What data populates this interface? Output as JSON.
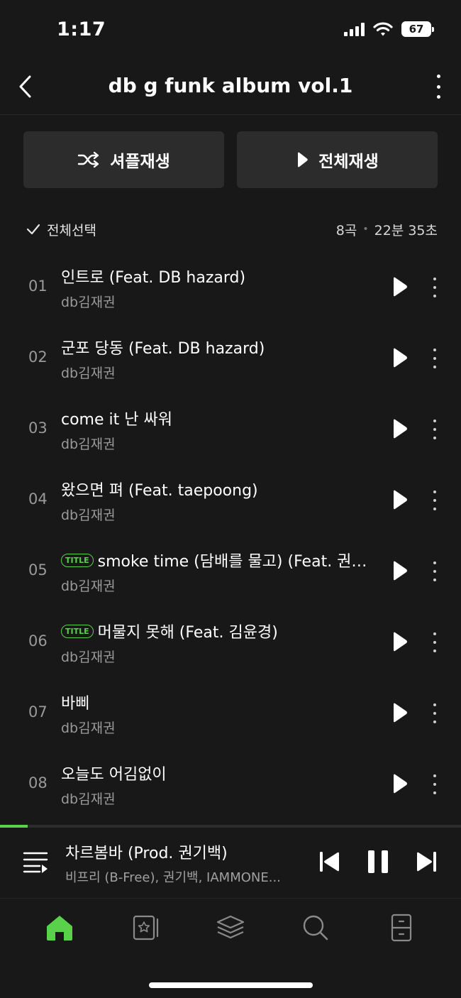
{
  "status_bar": {
    "time": "1:17",
    "battery": "67"
  },
  "header": {
    "title": "db g funk album vol.1"
  },
  "actions": {
    "shuffle_label": "셔플재생",
    "play_all_label": "전체재생"
  },
  "list_meta": {
    "select_all_label": "전체선택",
    "track_count": "8곡",
    "duration": "22분 35초"
  },
  "badge_text": "TITLE",
  "tracks": [
    {
      "num": "01",
      "title": "인트로 (Feat. DB hazard)",
      "artist": "db김재권",
      "is_title": false
    },
    {
      "num": "02",
      "title": "군포 당동 (Feat. DB hazard)",
      "artist": "db김재권",
      "is_title": false
    },
    {
      "num": "03",
      "title": "come it 난 싸워",
      "artist": "db김재권",
      "is_title": false
    },
    {
      "num": "04",
      "title": "왔으면 펴 (Feat. taepoong)",
      "artist": "db김재권",
      "is_title": false
    },
    {
      "num": "05",
      "title": "smoke time (담배를 물고) (Feat. 권…",
      "artist": "db김재권",
      "is_title": true
    },
    {
      "num": "06",
      "title": "머물지 못해 (Feat. 김윤경)",
      "artist": "db김재권",
      "is_title": true
    },
    {
      "num": "07",
      "title": "바삐",
      "artist": "db김재권",
      "is_title": false
    },
    {
      "num": "08",
      "title": "오늘도 어김없이",
      "artist": "db김재권",
      "is_title": false
    }
  ],
  "now_playing": {
    "title": "차르봄바 (Prod. 권기백)",
    "artist": "비프리 (B-Free), 권기백, IAMMONE...",
    "progress": 0.06
  },
  "tabs": [
    {
      "name": "home",
      "active": true
    },
    {
      "name": "library",
      "active": false
    },
    {
      "name": "layers",
      "active": false
    },
    {
      "name": "search",
      "active": false
    },
    {
      "name": "storage",
      "active": false
    }
  ],
  "colors": {
    "accent": "#5ad14a",
    "background": "#181818",
    "button_bg": "#2c2c2c",
    "muted_text": "#9a9a9a"
  }
}
